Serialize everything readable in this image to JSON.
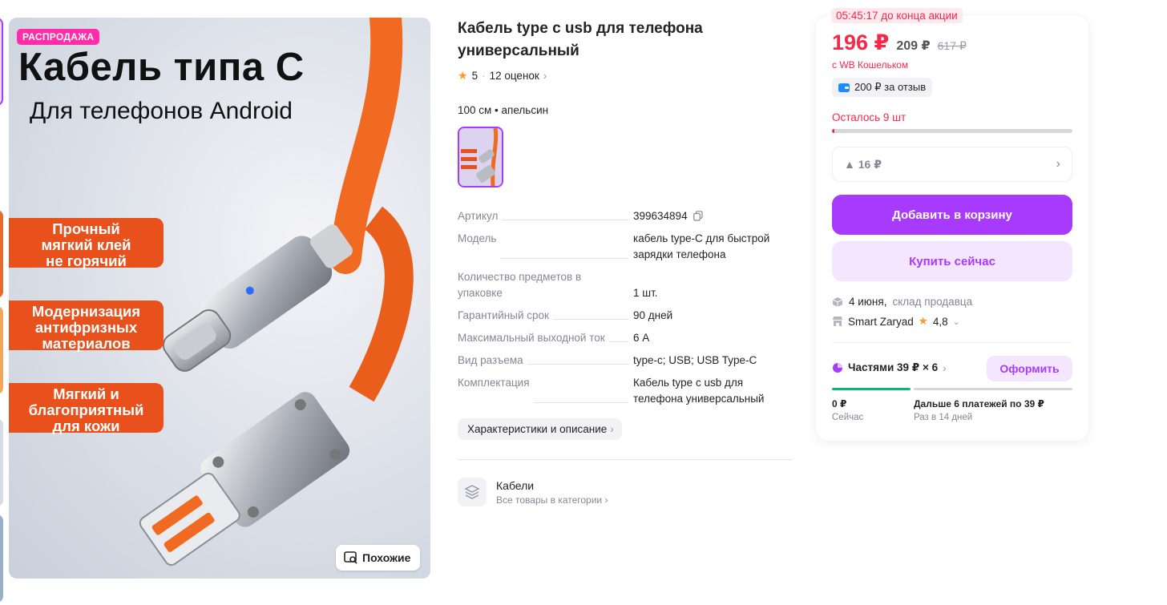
{
  "gallery": {
    "badge": "РАСПРОДАЖА",
    "headline": "Кабель типа С",
    "subheadline": "Для телефонов Android",
    "features": [
      "Прочный\nмягкий клей\nне горячий",
      "Модернизация\nантифризных\nматериалов",
      "Мягкий и\nблагоприятный\nдля кожи"
    ],
    "similar_label": "Похожие"
  },
  "product": {
    "title": "Кабель type c usb для телефона универсальный",
    "rating": "5",
    "reviews": "12 оценок",
    "variant": "100 см • апельсин"
  },
  "specs": [
    {
      "key": "Артикул",
      "value": "399634894"
    },
    {
      "key": "Модель",
      "value": "кабель type-C для быстрой зарядки телефона"
    },
    {
      "key": "Количество предметов в упаковке",
      "value": "1 шт."
    },
    {
      "key": "Гарантийный срок",
      "value": "90 дней"
    },
    {
      "key": "Максимальный выходной ток",
      "value": "6 А"
    },
    {
      "key": "Вид разъема",
      "value": "type-c; USB; USB Type-C"
    },
    {
      "key": "Комплектация",
      "value": "Кабель type c usb для телефона универсальный"
    }
  ],
  "details_button": "Характеристики и описание",
  "category": {
    "name": "Кабели",
    "link": "Все товары в категории"
  },
  "offer": {
    "timer": "05:45:17 до конца акции",
    "price": "196 ₽",
    "price_no_wallet": "209 ₽",
    "price_old": "617 ₽",
    "wallet_note": "с WB Кошельком",
    "review_bonus": "200 ₽ за отзыв",
    "remaining": "Осталось 9 шт",
    "remaining_level": 0.01,
    "price_change": "▲ 16 ₽",
    "add_to_cart": "Добавить в корзину",
    "buy_now": "Купить сейчас",
    "delivery_date": "4 июня,",
    "delivery_source": "склад продавца",
    "seller": "Smart Zaryad",
    "seller_rating": "4,8",
    "installments": "Частями 39 ₽ × 6",
    "apply": "Оформить",
    "pay_now": "0 ₽",
    "pay_now_sub": "Сейчас",
    "pay_later": "Дальше 6 платежей по 39 ₽",
    "pay_later_sub": "Раз в 14 дней"
  },
  "colors": {
    "accent": "#a73afd",
    "price": "#f5284a",
    "feature": "#e8501c",
    "cable": "#f06a22"
  }
}
